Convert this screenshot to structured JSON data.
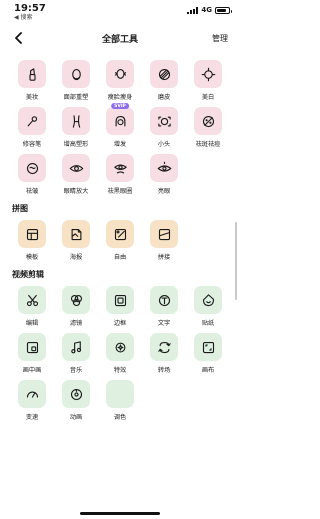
{
  "status_bar": {
    "time": "19:57",
    "back_app": "◀ 搜索",
    "network": "4G",
    "battery_level": 0.8
  },
  "nav": {
    "title": "全部工具",
    "manage": "管理"
  },
  "sections": [
    {
      "id": "beauty",
      "title": "",
      "color": "pink",
      "tools": [
        {
          "label": "美妆",
          "icon": "lipstick-icon"
        },
        {
          "label": "面部重塑",
          "icon": "face-reshape-icon"
        },
        {
          "label": "瘦脸瘦身",
          "icon": "slim-face-icon"
        },
        {
          "label": "磨皮",
          "icon": "smooth-skin-icon"
        },
        {
          "label": "美白",
          "icon": "whitening-icon"
        },
        {
          "label": "修容笔",
          "icon": "contour-pen-icon"
        },
        {
          "label": "增高塑形",
          "icon": "body-shape-icon"
        },
        {
          "label": "增发",
          "icon": "hair-icon",
          "badge": "SVIP"
        },
        {
          "label": "小头",
          "icon": "small-head-icon"
        },
        {
          "label": "祛斑祛痘",
          "icon": "acne-removal-icon"
        },
        {
          "label": "祛皱",
          "icon": "wrinkle-removal-icon"
        },
        {
          "label": "眼睛放大",
          "icon": "eye-enlarge-icon"
        },
        {
          "label": "祛黑眼圈",
          "icon": "dark-circle-icon"
        },
        {
          "label": "亮眼",
          "icon": "bright-eye-icon"
        }
      ]
    },
    {
      "id": "collage",
      "title": "拼图",
      "color": "orange",
      "tools": [
        {
          "label": "模板",
          "icon": "template-icon"
        },
        {
          "label": "海报",
          "icon": "poster-icon"
        },
        {
          "label": "自由",
          "icon": "free-collage-icon"
        },
        {
          "label": "拼接",
          "icon": "stitch-icon"
        }
      ]
    },
    {
      "id": "video",
      "title": "视频剪辑",
      "color": "green",
      "tools": [
        {
          "label": "编辑",
          "icon": "scissors-icon"
        },
        {
          "label": "滤镜",
          "icon": "filter-icon"
        },
        {
          "label": "边框",
          "icon": "frame-icon"
        },
        {
          "label": "文字",
          "icon": "text-icon"
        },
        {
          "label": "贴纸",
          "icon": "sticker-icon"
        },
        {
          "label": "画中画",
          "icon": "pip-icon"
        },
        {
          "label": "音乐",
          "icon": "music-icon"
        },
        {
          "label": "特效",
          "icon": "effects-icon"
        },
        {
          "label": "转场",
          "icon": "transition-icon"
        },
        {
          "label": "画布",
          "icon": "canvas-icon"
        },
        {
          "label": "变速",
          "icon": "speed-icon"
        },
        {
          "label": "动画",
          "icon": "animation-icon"
        },
        {
          "label": "调色",
          "icon": "color-grade-icon"
        }
      ]
    }
  ]
}
